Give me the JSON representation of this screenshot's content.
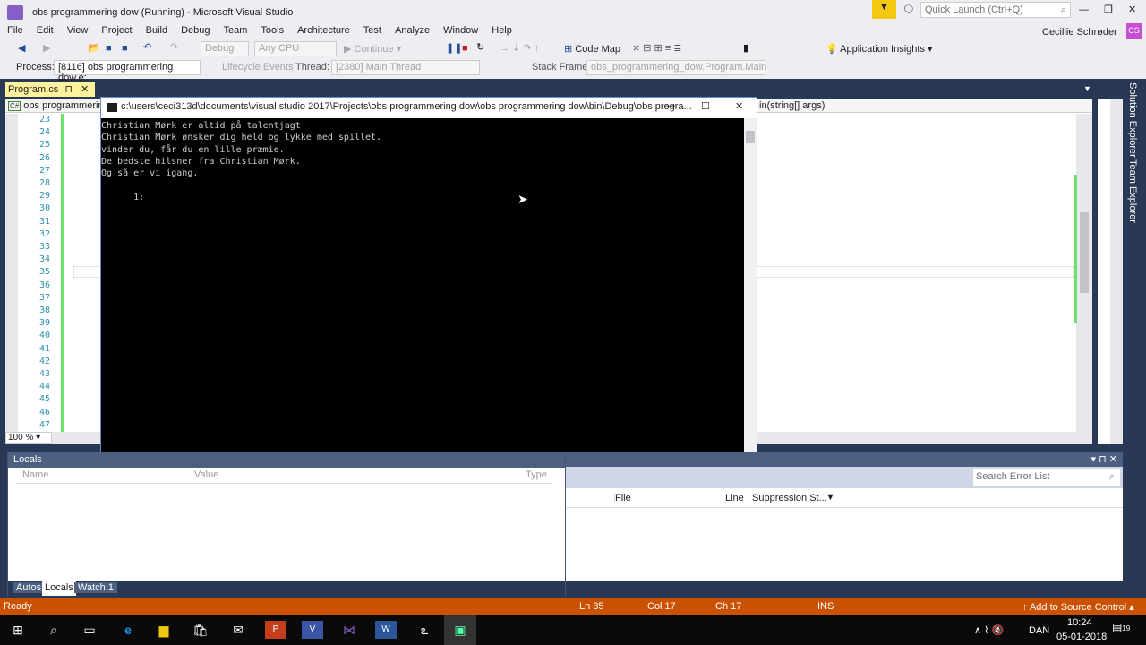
{
  "window": {
    "title": "obs programmering dow (Running) - Microsoft Visual Studio",
    "quick_launch_placeholder": "Quick Launch (Ctrl+Q)",
    "user": "Cecillie Schrøder",
    "user_initials": "CS"
  },
  "menu": [
    "File",
    "Edit",
    "View",
    "Project",
    "Build",
    "Debug",
    "Team",
    "Tools",
    "Architecture",
    "Test",
    "Analyze",
    "Window",
    "Help"
  ],
  "toolbar": {
    "config": "Debug",
    "platform": "Any CPU",
    "continue": "Continue",
    "code_map": "Code Map",
    "app_insights": "Application Insights"
  },
  "debug_location": {
    "process_label": "Process:",
    "process": "[8116] obs programmering dow.e:",
    "lifecycle": "Lifecycle Events",
    "thread_label": "Thread:",
    "thread": "[2380] Main Thread",
    "stack_label": "Stack Frame:",
    "stack": "obs_programmering_dow.Program.Main"
  },
  "editor": {
    "tab": "Program.cs",
    "project_nav": "obs programmering",
    "member_nav": "in(string[] args)",
    "line_numbers": [
      "23",
      "24",
      "25",
      "26",
      "27",
      "28",
      "29",
      "30",
      "31",
      "32",
      "33",
      "34",
      "35",
      "36",
      "37",
      "38",
      "39",
      "40",
      "41",
      "42",
      "43",
      "44",
      "45",
      "46",
      "47"
    ],
    "zoom": "100 %"
  },
  "console": {
    "title": "c:\\users\\ceci313d\\documents\\visual studio 2017\\Projects\\obs programmering dow\\obs programmering dow\\bin\\Debug\\obs progra...",
    "lines": [
      "Christian Mørk er altid på talentjagt",
      "Christian Mørk ønsker dig held og lykke med spillet.",
      "vinder du, får du en lille præmie.",
      "De bedste hilsner fra Christian Mørk.",
      "Og så er vi igang.",
      "",
      "      1: _"
    ]
  },
  "locals": {
    "title": "Locals",
    "columns": [
      "Name",
      "Value",
      "Type"
    ],
    "tabs": [
      "Autos",
      "Locals",
      "Watch 1"
    ],
    "active_tab": "Locals"
  },
  "error_list": {
    "search_placeholder": "Search Error List",
    "columns": [
      "File",
      "Line",
      "Suppression St..."
    ]
  },
  "side_tabs": [
    "Solution Explorer",
    "Team Explorer"
  ],
  "status": {
    "text": "Ready",
    "ln": "Ln 35",
    "col": "Col 17",
    "ch": "Ch 17",
    "mode": "INS",
    "source_control": "Add to Source Control"
  },
  "taskbar": {
    "lang": "DAN",
    "time": "10:24",
    "date": "05-01-2018",
    "notifications": "19"
  },
  "colors": {
    "status_bar": "#ca5100",
    "chrome": "#eeeef2",
    "dark": "#293955",
    "doc_tab": "#fff29d"
  }
}
